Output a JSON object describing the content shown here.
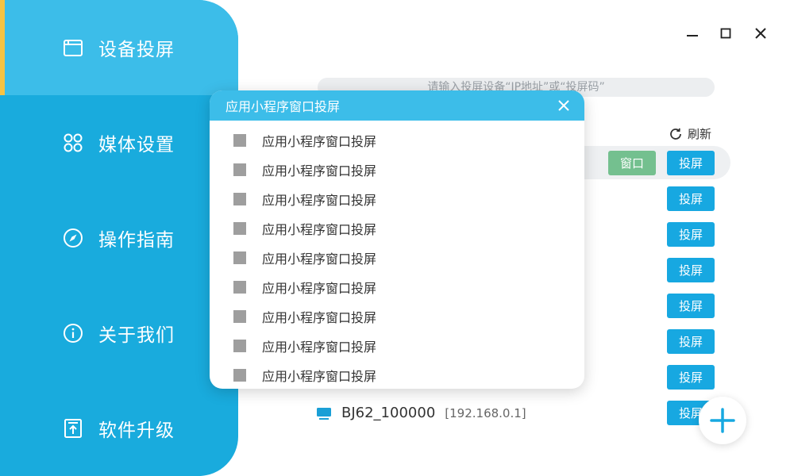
{
  "window_controls": {
    "minimize_icon": "minimize-icon",
    "maximize_icon": "maximize-icon",
    "close_icon": "close-icon"
  },
  "sidebar": {
    "accent_color": "#f6c343",
    "bg_color": "#19abdd",
    "active_color": "#3cbde9",
    "items": [
      {
        "label": "设备投屏",
        "icon": "window-icon",
        "active": true
      },
      {
        "label": "媒体设置",
        "icon": "grid-settings-icon",
        "active": false
      },
      {
        "label": "操作指南",
        "icon": "compass-icon",
        "active": false
      },
      {
        "label": "关于我们",
        "icon": "info-icon",
        "active": false
      },
      {
        "label": "软件升级",
        "icon": "upgrade-icon",
        "active": false
      }
    ]
  },
  "search": {
    "placeholder": "请输入投屏设备“IP地址”或“投屏码”"
  },
  "refresh": {
    "label": "刷新",
    "icon": "refresh-icon"
  },
  "device_list": {
    "window_label": "窗口",
    "cast_label": "投屏",
    "rows": [
      {
        "cast_label": "投屏"
      },
      {
        "cast_label": "投屏"
      },
      {
        "cast_label": "投屏"
      },
      {
        "cast_label": "投屏"
      },
      {
        "cast_label": "投屏"
      },
      {
        "cast_label": "投屏"
      },
      {
        "cast_label": "投屏"
      },
      {
        "cast_label": "投屏"
      }
    ],
    "visible_device": {
      "name": "BJ62_100000",
      "ip": "[192.168.0.1]",
      "icon": "monitor-icon"
    }
  },
  "fab": {
    "icon": "plus-icon",
    "color": "#17a8e1"
  },
  "dialog": {
    "title": "应用小程序窗口投屏",
    "close_icon": "close-icon",
    "items": [
      {
        "label": "应用小程序窗口投屏"
      },
      {
        "label": "应用小程序窗口投屏"
      },
      {
        "label": "应用小程序窗口投屏"
      },
      {
        "label": "应用小程序窗口投屏"
      },
      {
        "label": "应用小程序窗口投屏"
      },
      {
        "label": "应用小程序窗口投屏"
      },
      {
        "label": "应用小程序窗口投屏"
      },
      {
        "label": "应用小程序窗口投屏"
      },
      {
        "label": "应用小程序窗口投屏"
      }
    ]
  }
}
